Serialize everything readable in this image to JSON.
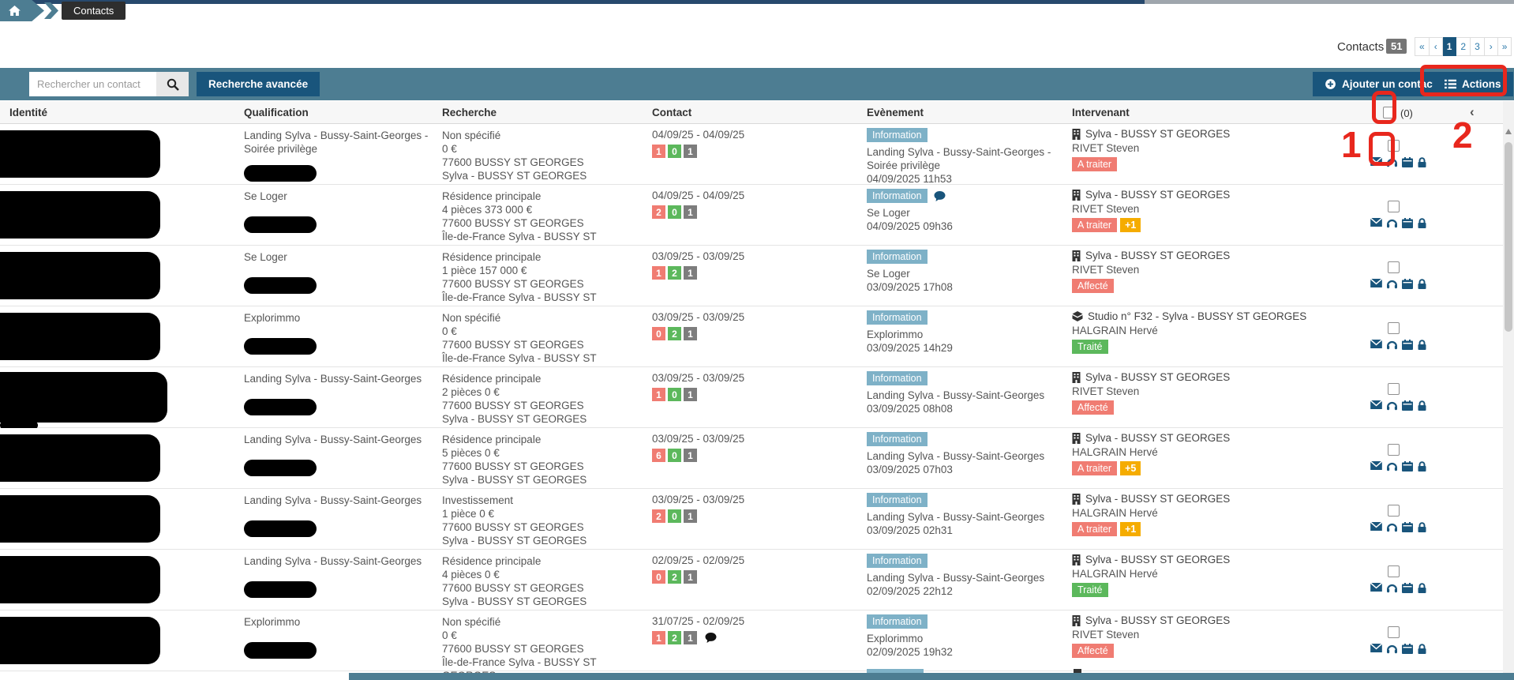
{
  "breadcrumb": {
    "home_icon": "home-icon",
    "label": "Contacts"
  },
  "pagination": {
    "label": "Contacts",
    "count": "51",
    "first": "«",
    "prev": "‹",
    "active": "1",
    "pages": [
      "2",
      "3"
    ],
    "next": "›",
    "last": "»"
  },
  "toolbar": {
    "search_placeholder": "Rechercher un contact",
    "search_icon": "magnifier-icon",
    "advanced_label": "Recherche avancée",
    "add_label": "Ajouter un contact",
    "actions_label": "Actions"
  },
  "colors": {
    "toolbar_slate": "#4d7d92",
    "button_navy": "#19557c",
    "info_badge": "#7eb1c7",
    "status_red": "#f07c72",
    "status_green": "#5cb85c",
    "count_gray": "#7d7d7d",
    "extra_amber": "#f5ac00",
    "annotation_red": "#e8271d"
  },
  "table": {
    "headers": [
      "Identité",
      "Qualification",
      "Recherche",
      "Contact",
      "Evènement",
      "Intervenant"
    ],
    "selection_count": "(0)",
    "collapse_icon": "‹",
    "rows": [
      {
        "qualification": "Landing Sylva - Bussy-Saint-Georges - Soirée privilège",
        "search_lines": [
          "Non spécifié",
          "0 €",
          "77600 BUSSY ST GEORGES",
          "Sylva - BUSSY ST GEORGES"
        ],
        "date_range": "04/09/25 - 04/09/25",
        "counts": {
          "red": "1",
          "green": "0",
          "gray": "1"
        },
        "contact_has_comment": false,
        "event": {
          "badge": "Information",
          "has_comment": false,
          "title": "Landing Sylva - Bussy-Saint-Georges - Soirée privilège",
          "datetime": "04/09/2025 11h53"
        },
        "intervenant": {
          "icon": "building",
          "company": "Sylva - BUSSY ST GEORGES",
          "name": "RIVET Steven",
          "status": "A traiter",
          "status_type": "red",
          "extra": null
        }
      },
      {
        "qualification": "Se Loger",
        "search_lines": [
          "Résidence principale",
          "4 pièces 373 000 €",
          "77600 BUSSY ST GEORGES",
          "Île-de-France Sylva - BUSSY ST GEORGES"
        ],
        "date_range": "04/09/25 - 04/09/25",
        "counts": {
          "red": "2",
          "green": "0",
          "gray": "1"
        },
        "contact_has_comment": false,
        "event": {
          "badge": "Information",
          "has_comment": true,
          "title": "Se Loger",
          "datetime": "04/09/2025 09h36"
        },
        "intervenant": {
          "icon": "building",
          "company": "Sylva - BUSSY ST GEORGES",
          "name": "RIVET Steven",
          "status": "A traiter",
          "status_type": "red",
          "extra": "+1"
        }
      },
      {
        "qualification": "Se Loger",
        "search_lines": [
          "Résidence principale",
          "1 pièce 157 000 €",
          "77600 BUSSY ST GEORGES",
          "Île-de-France Sylva - BUSSY ST GEORGES"
        ],
        "date_range": "03/09/25 - 03/09/25",
        "counts": {
          "red": "1",
          "green": "2",
          "gray": "1"
        },
        "contact_has_comment": false,
        "event": {
          "badge": "Information",
          "has_comment": false,
          "title": "Se Loger",
          "datetime": "03/09/2025 17h08"
        },
        "intervenant": {
          "icon": "building",
          "company": "Sylva - BUSSY ST GEORGES",
          "name": "RIVET Steven",
          "status": "Affecté",
          "status_type": "red",
          "extra": null
        }
      },
      {
        "qualification": "Explorimmo",
        "search_lines": [
          "Non spécifié",
          "0 €",
          "77600 BUSSY ST GEORGES",
          "Île-de-France Sylva - BUSSY ST GEORGES"
        ],
        "date_range": "03/09/25 - 03/09/25",
        "counts": {
          "red": "0",
          "green": "2",
          "gray": "1"
        },
        "contact_has_comment": false,
        "event": {
          "badge": "Information",
          "has_comment": false,
          "title": "Explorimmo",
          "datetime": "03/09/2025 14h29"
        },
        "intervenant": {
          "icon": "cube",
          "company": "Studio n° F32 - Sylva - BUSSY ST GEORGES",
          "name": "HALGRAIN Hervé",
          "status": "Traité",
          "status_type": "green",
          "extra": null
        }
      },
      {
        "qualification": "Landing Sylva - Bussy-Saint-Georges",
        "search_lines": [
          "Résidence principale",
          "2 pièces 0 €",
          "77600 BUSSY ST GEORGES",
          "Sylva - BUSSY ST GEORGES"
        ],
        "date_range": "03/09/25 - 03/09/25",
        "counts": {
          "red": "1",
          "green": "0",
          "gray": "1"
        },
        "contact_has_comment": false,
        "event": {
          "badge": "Information",
          "has_comment": false,
          "title": "Landing Sylva - Bussy-Saint-Georges",
          "datetime": "03/09/2025 08h08"
        },
        "intervenant": {
          "icon": "building",
          "company": "Sylva - BUSSY ST GEORGES",
          "name": "RIVET Steven",
          "status": "Affecté",
          "status_type": "red",
          "extra": null
        }
      },
      {
        "qualification": "Landing Sylva - Bussy-Saint-Georges",
        "search_lines": [
          "Résidence principale",
          "5 pièces 0 €",
          "77600 BUSSY ST GEORGES",
          "Sylva - BUSSY ST GEORGES"
        ],
        "date_range": "03/09/25 - 03/09/25",
        "counts": {
          "red": "6",
          "green": "0",
          "gray": "1"
        },
        "contact_has_comment": false,
        "event": {
          "badge": "Information",
          "has_comment": false,
          "title": "Landing Sylva - Bussy-Saint-Georges",
          "datetime": "03/09/2025 07h03"
        },
        "intervenant": {
          "icon": "building",
          "company": "Sylva - BUSSY ST GEORGES",
          "name": "HALGRAIN Hervé",
          "status": "A traiter",
          "status_type": "red",
          "extra": "+5"
        }
      },
      {
        "qualification": "Landing Sylva - Bussy-Saint-Georges",
        "search_lines": [
          "Investissement",
          "1 pièce 0 €",
          "77600 BUSSY ST GEORGES",
          "Sylva - BUSSY ST GEORGES"
        ],
        "date_range": "03/09/25 - 03/09/25",
        "counts": {
          "red": "2",
          "green": "0",
          "gray": "1"
        },
        "contact_has_comment": false,
        "event": {
          "badge": "Information",
          "has_comment": false,
          "title": "Landing Sylva - Bussy-Saint-Georges",
          "datetime": "03/09/2025 02h31"
        },
        "intervenant": {
          "icon": "building",
          "company": "Sylva - BUSSY ST GEORGES",
          "name": "HALGRAIN Hervé",
          "status": "A traiter",
          "status_type": "red",
          "extra": "+1"
        }
      },
      {
        "qualification": "Landing Sylva - Bussy-Saint-Georges",
        "search_lines": [
          "Résidence principale",
          "4 pièces 0 €",
          "77600 BUSSY ST GEORGES",
          "Sylva - BUSSY ST GEORGES"
        ],
        "date_range": "02/09/25 - 02/09/25",
        "counts": {
          "red": "0",
          "green": "2",
          "gray": "1"
        },
        "contact_has_comment": false,
        "event": {
          "badge": "Information",
          "has_comment": false,
          "title": "Landing Sylva - Bussy-Saint-Georges",
          "datetime": "02/09/2025 22h12"
        },
        "intervenant": {
          "icon": "building",
          "company": "Sylva - BUSSY ST GEORGES",
          "name": "HALGRAIN Hervé",
          "status": "Traité",
          "status_type": "green",
          "extra": null
        }
      },
      {
        "qualification": "Explorimmo",
        "search_lines": [
          "Non spécifié",
          "0 €",
          "77600 BUSSY ST GEORGES",
          "Île-de-France Sylva - BUSSY ST GEORGES"
        ],
        "date_range": "31/07/25 - 02/09/25",
        "counts": {
          "red": "1",
          "green": "2",
          "gray": "1"
        },
        "contact_has_comment": true,
        "event": {
          "badge": "Information",
          "has_comment": false,
          "title": "Explorimmo",
          "datetime": "02/09/2025 19h32"
        },
        "intervenant": {
          "icon": "building",
          "company": "Sylva - BUSSY ST GEORGES",
          "name": "RIVET Steven",
          "status": "Affecté",
          "status_type": "red",
          "extra": null
        }
      }
    ]
  },
  "annotations": {
    "digit_1": "1",
    "digit_2": "2"
  }
}
